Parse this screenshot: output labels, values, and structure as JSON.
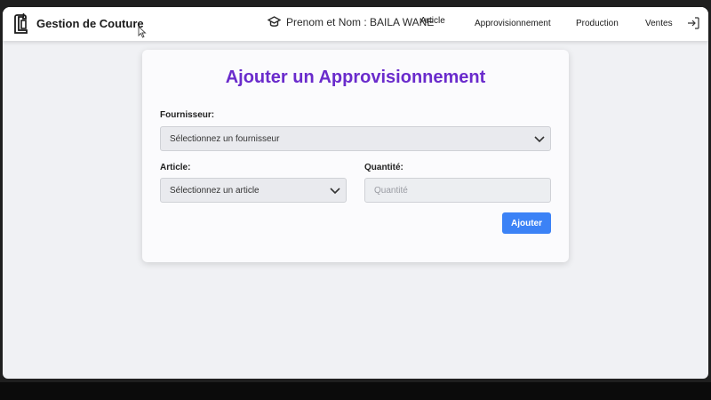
{
  "brand": {
    "title": "Gestion de Couture",
    "icon": "sewing-machine-icon"
  },
  "user": {
    "label": "Prenom et Nom : BAILA WANE",
    "icon": "graduation-cap-icon"
  },
  "nav": {
    "article": "Article",
    "approvisionnement": "Approvisionnement",
    "production": "Production",
    "ventes": "Ventes",
    "logout_icon": "logout-icon"
  },
  "form": {
    "title": "Ajouter un Approvisionnement",
    "fournisseur_label": "Fournisseur:",
    "fournisseur_value": "Sélectionnez un fournisseur",
    "article_label": "Article:",
    "article_value": "Sélectionnez un article",
    "quantite_label": "Quantité:",
    "quantite_placeholder": "Quantité",
    "submit_label": "Ajouter"
  },
  "colors": {
    "title": "#6a2bcc",
    "button": "#3b82f6",
    "background": "#f0f1f4"
  }
}
